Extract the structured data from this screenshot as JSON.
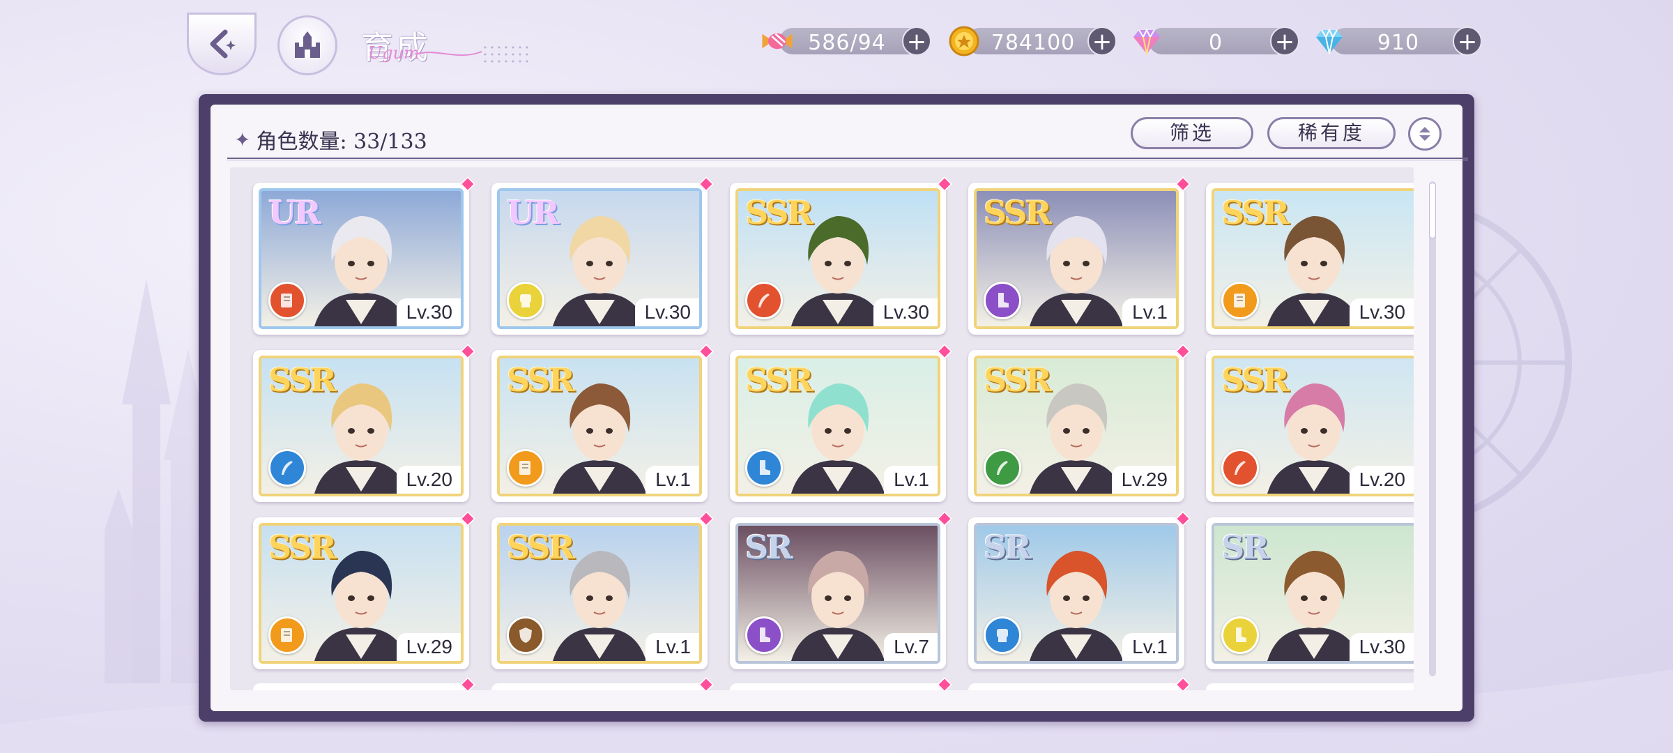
{
  "header": {
    "title": "育成",
    "title_script": "Ugum",
    "resources": [
      {
        "icon": "candy-icon",
        "value": "586/94"
      },
      {
        "icon": "coin-icon",
        "value": "784100"
      },
      {
        "icon": "rainbow-gem-icon",
        "value": "0"
      },
      {
        "icon": "diamond-icon",
        "value": "910"
      }
    ],
    "plus": "+"
  },
  "panel": {
    "count_label": "角色数量: 33/133",
    "filter_label": "筛选",
    "rarity_label": "稀有度"
  },
  "colors": {
    "panel_border": "#4c3f69",
    "attr_red": "#e2522f",
    "attr_yellow": "#ead23a",
    "attr_purple": "#8b4fc7",
    "attr_orange": "#f19a1c",
    "attr_blue": "#2f86d6",
    "attr_green": "#3f9a44",
    "attr_brown": "#8a5a2c",
    "gem_pink": "#ff4f9a"
  },
  "cards": [
    {
      "rarity": "UR",
      "level": "Lv.30",
      "attr": "red",
      "attr_icon": "book-icon",
      "hair": "#e9e9ef",
      "sky": "#8ea9d8"
    },
    {
      "rarity": "UR",
      "level": "Lv.30",
      "attr": "yellow",
      "attr_icon": "fist-icon",
      "hair": "#f1d7a4",
      "sky": "#c7d8ee"
    },
    {
      "rarity": "SSR",
      "level": "Lv.30",
      "attr": "red",
      "attr_icon": "quill-icon",
      "hair": "#4b6b2a",
      "sky": "#bfe0f5"
    },
    {
      "rarity": "SSR",
      "level": "Lv.1",
      "attr": "purple",
      "attr_icon": "boot-icon",
      "hair": "#e4e2ee",
      "sky": "#8c8fb8"
    },
    {
      "rarity": "SSR",
      "level": "Lv.30",
      "attr": "orange",
      "attr_icon": "book-icon",
      "hair": "#7a5535",
      "sky": "#c9e6f4"
    },
    {
      "rarity": "SSR",
      "level": "Lv.20",
      "attr": "blue",
      "attr_icon": "quill-icon",
      "hair": "#e9c77e",
      "sky": "#c6e1f2"
    },
    {
      "rarity": "SSR",
      "level": "Lv.1",
      "attr": "orange",
      "attr_icon": "book-icon",
      "hair": "#8c5a38",
      "sky": "#c8e2f1"
    },
    {
      "rarity": "SSR",
      "level": "Lv.1",
      "attr": "blue",
      "attr_icon": "boot-icon",
      "hair": "#8fe0cf",
      "sky": "#d9efe7"
    },
    {
      "rarity": "SSR",
      "level": "Lv.29",
      "attr": "green",
      "attr_icon": "quill-icon",
      "hair": "#c9c7c1",
      "sky": "#d8ebd6"
    },
    {
      "rarity": "SSR",
      "level": "Lv.20",
      "attr": "red",
      "attr_icon": "quill-icon",
      "hair": "#d77ca6",
      "sky": "#cfe6f2"
    },
    {
      "rarity": "SSR",
      "level": "Lv.29",
      "attr": "orange",
      "attr_icon": "book-icon",
      "hair": "#2a3554",
      "sky": "#c7e0f1"
    },
    {
      "rarity": "SSR",
      "level": "Lv.1",
      "attr": "brown",
      "attr_icon": "shield-icon",
      "hair": "#b9b9bd",
      "sky": "#b9d2ee"
    },
    {
      "rarity": "SR",
      "level": "Lv.7",
      "attr": "purple",
      "attr_icon": "boot-icon",
      "hair": "#c8a9a6",
      "sky": "#6b4f62"
    },
    {
      "rarity": "SR",
      "level": "Lv.1",
      "attr": "blue",
      "attr_icon": "fist-icon",
      "hair": "#d9542a",
      "sky": "#9fc9e9"
    },
    {
      "rarity": "SR",
      "level": "Lv.30",
      "attr": "yellow",
      "attr_icon": "boot-icon",
      "hair": "#8b5a2e",
      "sky": "#cde6d0"
    }
  ]
}
